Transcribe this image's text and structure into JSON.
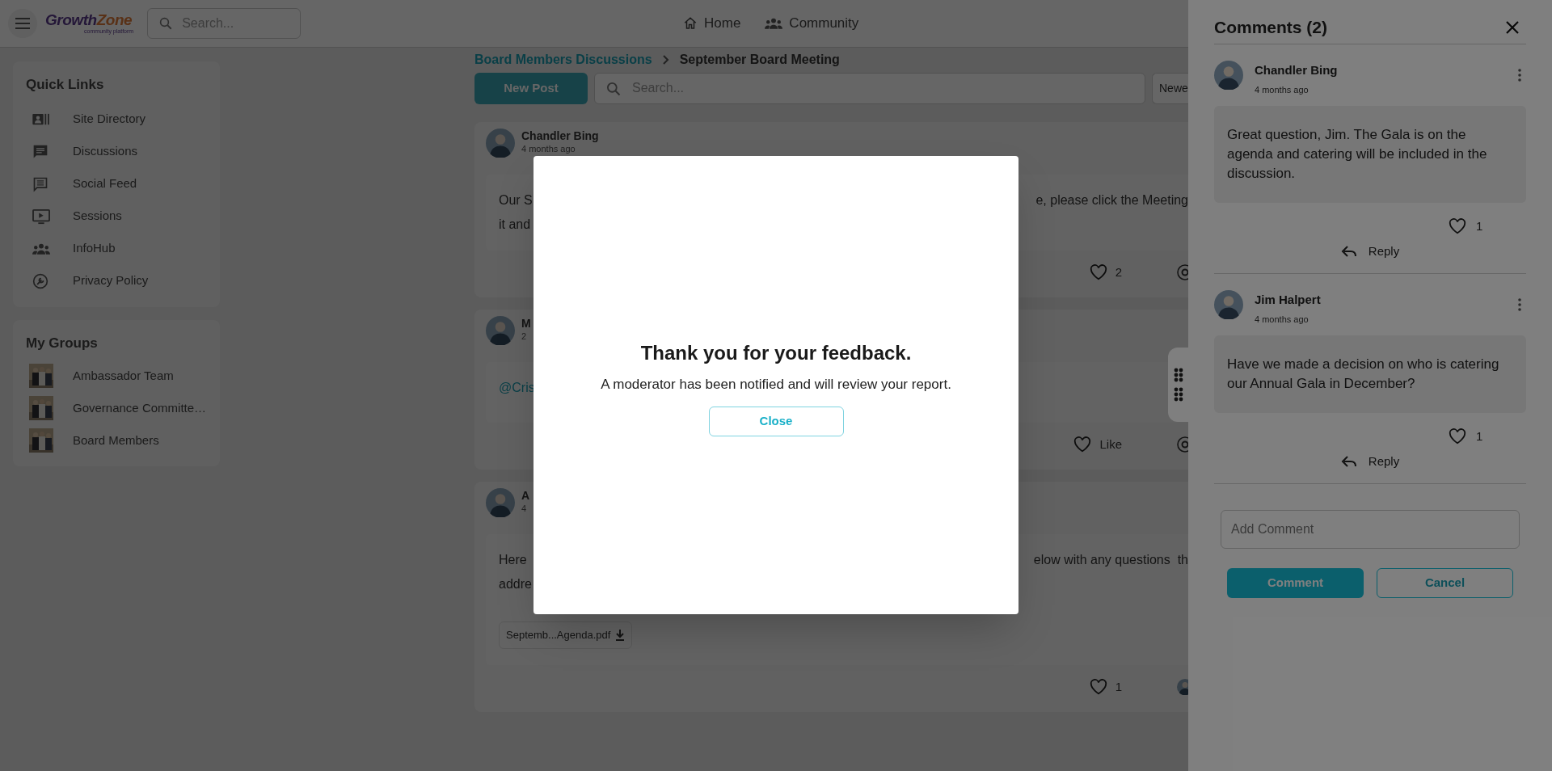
{
  "header": {
    "logo": {
      "primary": "Growth",
      "secondary": "Zone",
      "tagline": "community platform"
    },
    "search_placeholder": "Search...",
    "nav": [
      {
        "label": "Home"
      },
      {
        "label": "Community"
      }
    ]
  },
  "quick_links": {
    "title": "Quick Links",
    "items": [
      {
        "label": "Site Directory"
      },
      {
        "label": "Discussions"
      },
      {
        "label": "Social Feed"
      },
      {
        "label": "Sessions"
      },
      {
        "label": "InfoHub"
      },
      {
        "label": "Privacy Policy"
      }
    ]
  },
  "my_groups": {
    "title": "My Groups",
    "items": [
      {
        "label": "Ambassador Team"
      },
      {
        "label": "Governance Committe…"
      },
      {
        "label": "Board Members"
      }
    ]
  },
  "breadcrumb": [
    "Board Members Discussions",
    "September Board Meeting"
  ],
  "toolbar": {
    "new_post": "New Post",
    "search_placeholder": "Search...",
    "sort": "Newe"
  },
  "posts": [
    {
      "author": "Chandler Bing",
      "time": "4 months ago",
      "lines": [
        {
          "kind": "text",
          "left": "Our S",
          "right": "e, please click the Meeting"
        },
        {
          "kind": "text",
          "left": "it and"
        }
      ],
      "likes": "2"
    },
    {
      "author": "M",
      "time": "2",
      "lines": [
        {
          "kind": "mention",
          "left": "@Cris"
        }
      ],
      "likes": "Like"
    },
    {
      "author": "A",
      "time": "4",
      "lines": [
        {
          "kind": "text",
          "left": "Here",
          "right": "elow with any questions  th"
        },
        {
          "kind": "text",
          "left": "addre"
        }
      ],
      "attachment": "Septemb...Agenda.pdf",
      "likes": "1"
    }
  ],
  "comments": {
    "title": "Comments (2)",
    "items": [
      {
        "author": "Chandler Bing",
        "time": "4 months ago",
        "text": "Great question, Jim. The Gala is on the agenda and catering will be included in the discussion.",
        "likes": "1",
        "reply": "Reply"
      },
      {
        "author": "Jim Halpert",
        "time": "4 months ago",
        "text": "Have we made a decision on who is catering our Annual Gala in December?",
        "likes": "1",
        "reply": "Reply"
      }
    ],
    "input_placeholder": "Add Comment",
    "submit": "Comment",
    "cancel": "Cancel"
  },
  "modal": {
    "title": "Thank you for your feedback.",
    "message": "A moderator has been notified and will review your report.",
    "button": "Close"
  }
}
